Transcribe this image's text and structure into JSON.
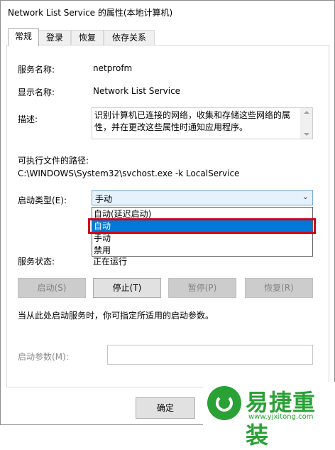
{
  "window": {
    "title": "Network List Service 的属性(本地计算机)"
  },
  "tabs": [
    {
      "label": "常规",
      "active": true
    },
    {
      "label": "登录",
      "active": false
    },
    {
      "label": "恢复",
      "active": false
    },
    {
      "label": "依存关系",
      "active": false
    }
  ],
  "general": {
    "service_name_label": "服务名称:",
    "service_name_value": "netprofm",
    "display_name_label": "显示名称:",
    "display_name_value": "Network List Service",
    "description_label": "描述:",
    "description_value": "识别计算机已连接的网络，收集和存储这些网络的属性，并在更改这些属性时通知应用程序。",
    "exe_path_label": "可执行文件的路径:",
    "exe_path_value": "C:\\WINDOWS\\System32\\svchost.exe -k LocalService",
    "startup_type_label": "启动类型(E):",
    "startup_type_value": "手动",
    "startup_options": [
      {
        "label": "自动(延迟启动)",
        "selected": false
      },
      {
        "label": "自动",
        "selected": true
      },
      {
        "label": "手动",
        "selected": false
      },
      {
        "label": "禁用",
        "selected": false
      }
    ],
    "service_status_label": "服务状态:",
    "service_status_value": "正在运行",
    "buttons": {
      "start": "启动(S)",
      "stop": "停止(T)",
      "pause": "暂停(P)",
      "resume": "恢复(R)"
    },
    "hint_text": "当从此处启动服务时，你可指定所适用的启动参数。",
    "start_params_label": "启动参数(M):",
    "start_params_value": ""
  },
  "footer": {
    "ok_label": "确定"
  },
  "watermark": {
    "text": "易捷重装",
    "url": "www.yjxitong.com"
  },
  "colors": {
    "selection": "#0078d7",
    "highlight_border": "#d0021b",
    "watermark": "#2aa135"
  }
}
